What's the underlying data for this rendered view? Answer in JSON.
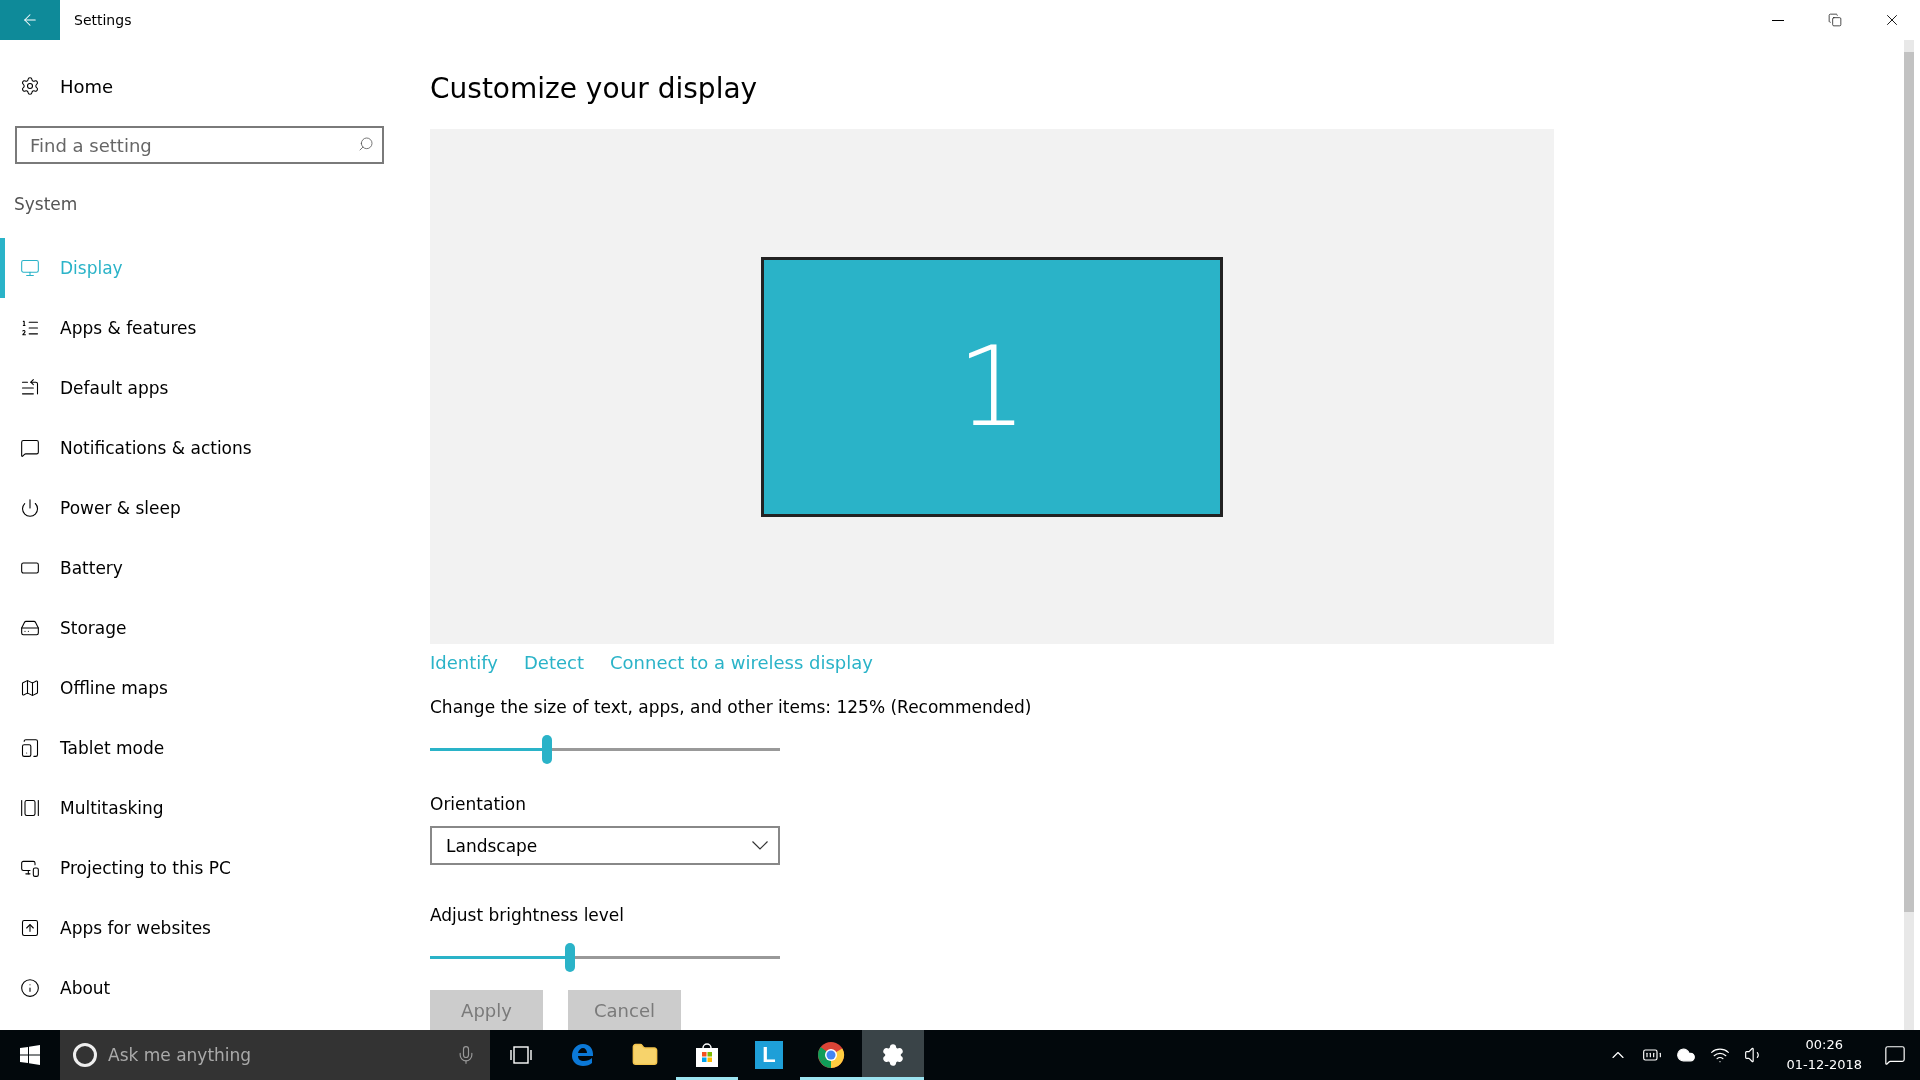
{
  "window": {
    "title": "Settings"
  },
  "sidebar": {
    "home": "Home",
    "search": {
      "placeholder": "Find a setting"
    },
    "section": "System",
    "items": [
      {
        "kind": "display",
        "label": "Display",
        "selected": true
      },
      {
        "kind": "apps",
        "label": "Apps & features",
        "selected": false
      },
      {
        "kind": "default-apps",
        "label": "Default apps",
        "selected": false
      },
      {
        "kind": "notifications",
        "label": "Notifications & actions",
        "selected": false
      },
      {
        "kind": "power",
        "label": "Power & sleep",
        "selected": false
      },
      {
        "kind": "battery",
        "label": "Battery",
        "selected": false
      },
      {
        "kind": "storage",
        "label": "Storage",
        "selected": false
      },
      {
        "kind": "maps",
        "label": "Offline maps",
        "selected": false
      },
      {
        "kind": "tablet",
        "label": "Tablet mode",
        "selected": false
      },
      {
        "kind": "multitasking",
        "label": "Multitasking",
        "selected": false
      },
      {
        "kind": "projecting",
        "label": "Projecting to this PC",
        "selected": false
      },
      {
        "kind": "websites",
        "label": "Apps for websites",
        "selected": false
      },
      {
        "kind": "about",
        "label": "About",
        "selected": false
      }
    ]
  },
  "content": {
    "title": "Customize your display",
    "monitor": "1",
    "links": [
      "Identify",
      "Detect",
      "Connect to a wireless display"
    ],
    "scale": {
      "label": "Change the size of text, apps, and other items: 125% (Recommended)",
      "level": 0.335
    },
    "orientation": {
      "label": "Orientation",
      "value": "Landscape"
    },
    "brightness": {
      "label": "Adjust brightness level",
      "level": 0.4
    },
    "buttons": [
      {
        "label": "Apply",
        "disabled": true
      },
      {
        "label": "Cancel",
        "disabled": true
      }
    ]
  },
  "taskbar": {
    "search": {
      "placeholder": "Ask me anything"
    },
    "apps": [
      {
        "kind": "task-view",
        "running": false,
        "selected": false
      },
      {
        "kind": "edge",
        "running": false,
        "selected": false
      },
      {
        "kind": "explorer",
        "running": false,
        "selected": false
      },
      {
        "kind": "store",
        "running": true,
        "selected": false
      },
      {
        "kind": "tile",
        "label": "L",
        "running": false,
        "selected": false
      },
      {
        "kind": "chrome",
        "running": true,
        "selected": false
      },
      {
        "kind": "settings",
        "running": true,
        "selected": true
      }
    ],
    "time": "00:26",
    "date": "01-12-2018"
  }
}
